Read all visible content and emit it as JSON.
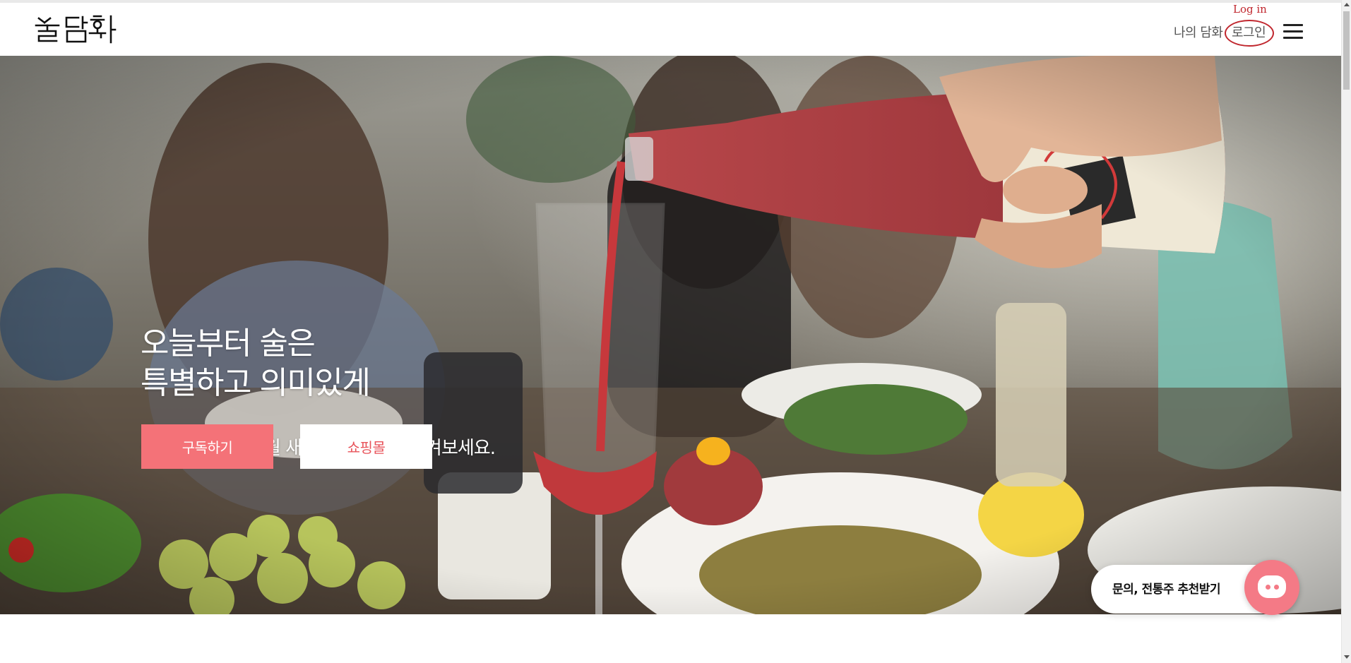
{
  "header": {
    "logo_text": "술담화",
    "nav_my": "나의 담화",
    "nav_login": "로그인",
    "login_annotation": "Log in",
    "annotation_color": "#c0262d"
  },
  "hero": {
    "title_line1": "오늘부터 술은",
    "title_line2": "특별하고 의미있게",
    "subtitle": "술담화와 함께 매월 새로운 전통주를 즐겨보세요.",
    "subscribe_label": "구독하기",
    "shop_label": "쇼핑몰",
    "accent_color": "#f47278"
  },
  "chat": {
    "label": "문의, 전통주 추천받기",
    "icon": "chat-bubble-icon",
    "color": "#f47a86"
  },
  "icons": {
    "menu": "hamburger-menu-icon"
  }
}
